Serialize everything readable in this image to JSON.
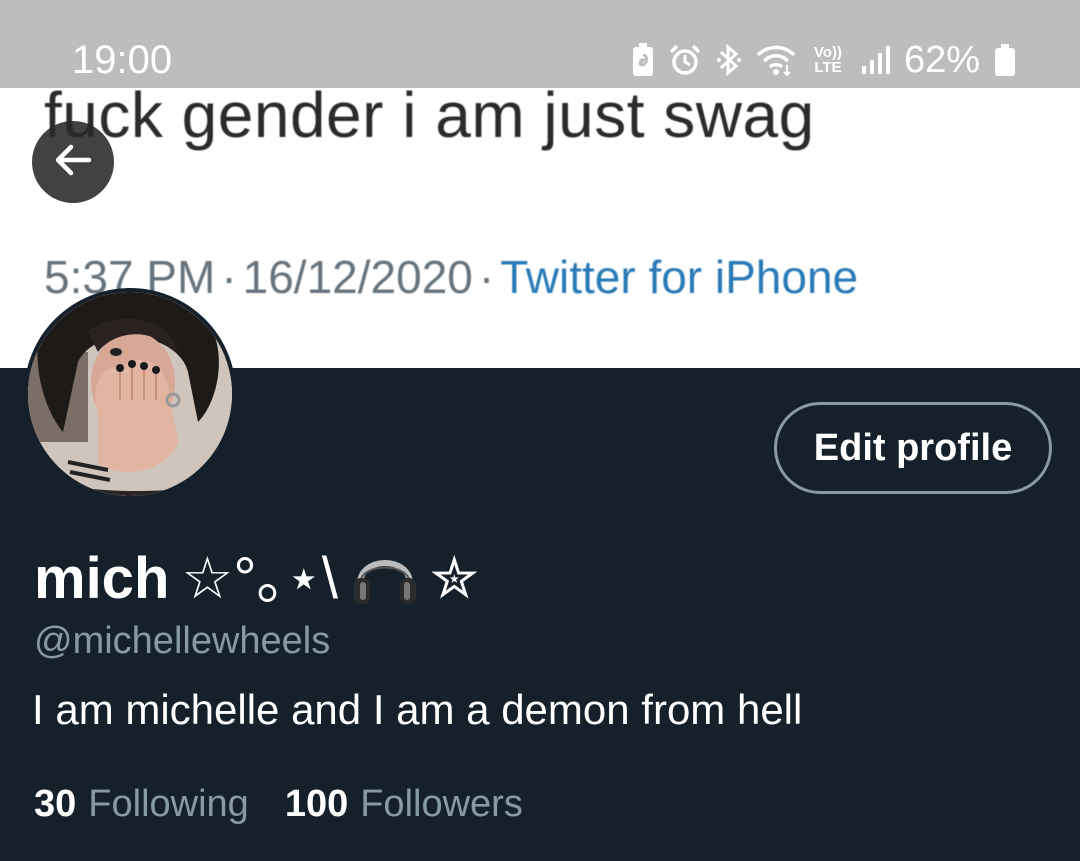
{
  "status_bar": {
    "time": "19:00",
    "network": "Vo)) LTE",
    "battery": "62%"
  },
  "banner": {
    "tweet_text": "fuck gender i am just swag",
    "tweet_time": "5:37 PM",
    "tweet_date": "16/12/2020",
    "tweet_source": "Twitter for iPhone"
  },
  "profile": {
    "edit_label": "Edit profile",
    "display_name": "mich",
    "name_decoration": "☆°｡⋆\\",
    "name_star": "✮",
    "handle": "@michellewheels",
    "bio": "I am michelle and I am a demon from hell",
    "following_count": "30",
    "following_label": "Following",
    "followers_count": "100",
    "followers_label": "Followers"
  },
  "colors": {
    "background": "#15202b",
    "secondary_text": "#8899a6",
    "link_blue": "#2a7bb8"
  },
  "icons": [
    "back-arrow-icon",
    "battery-saver-icon",
    "alarm-icon",
    "bluetooth-icon",
    "wifi-icon",
    "signal-icon",
    "battery-icon",
    "headphones-icon"
  ]
}
